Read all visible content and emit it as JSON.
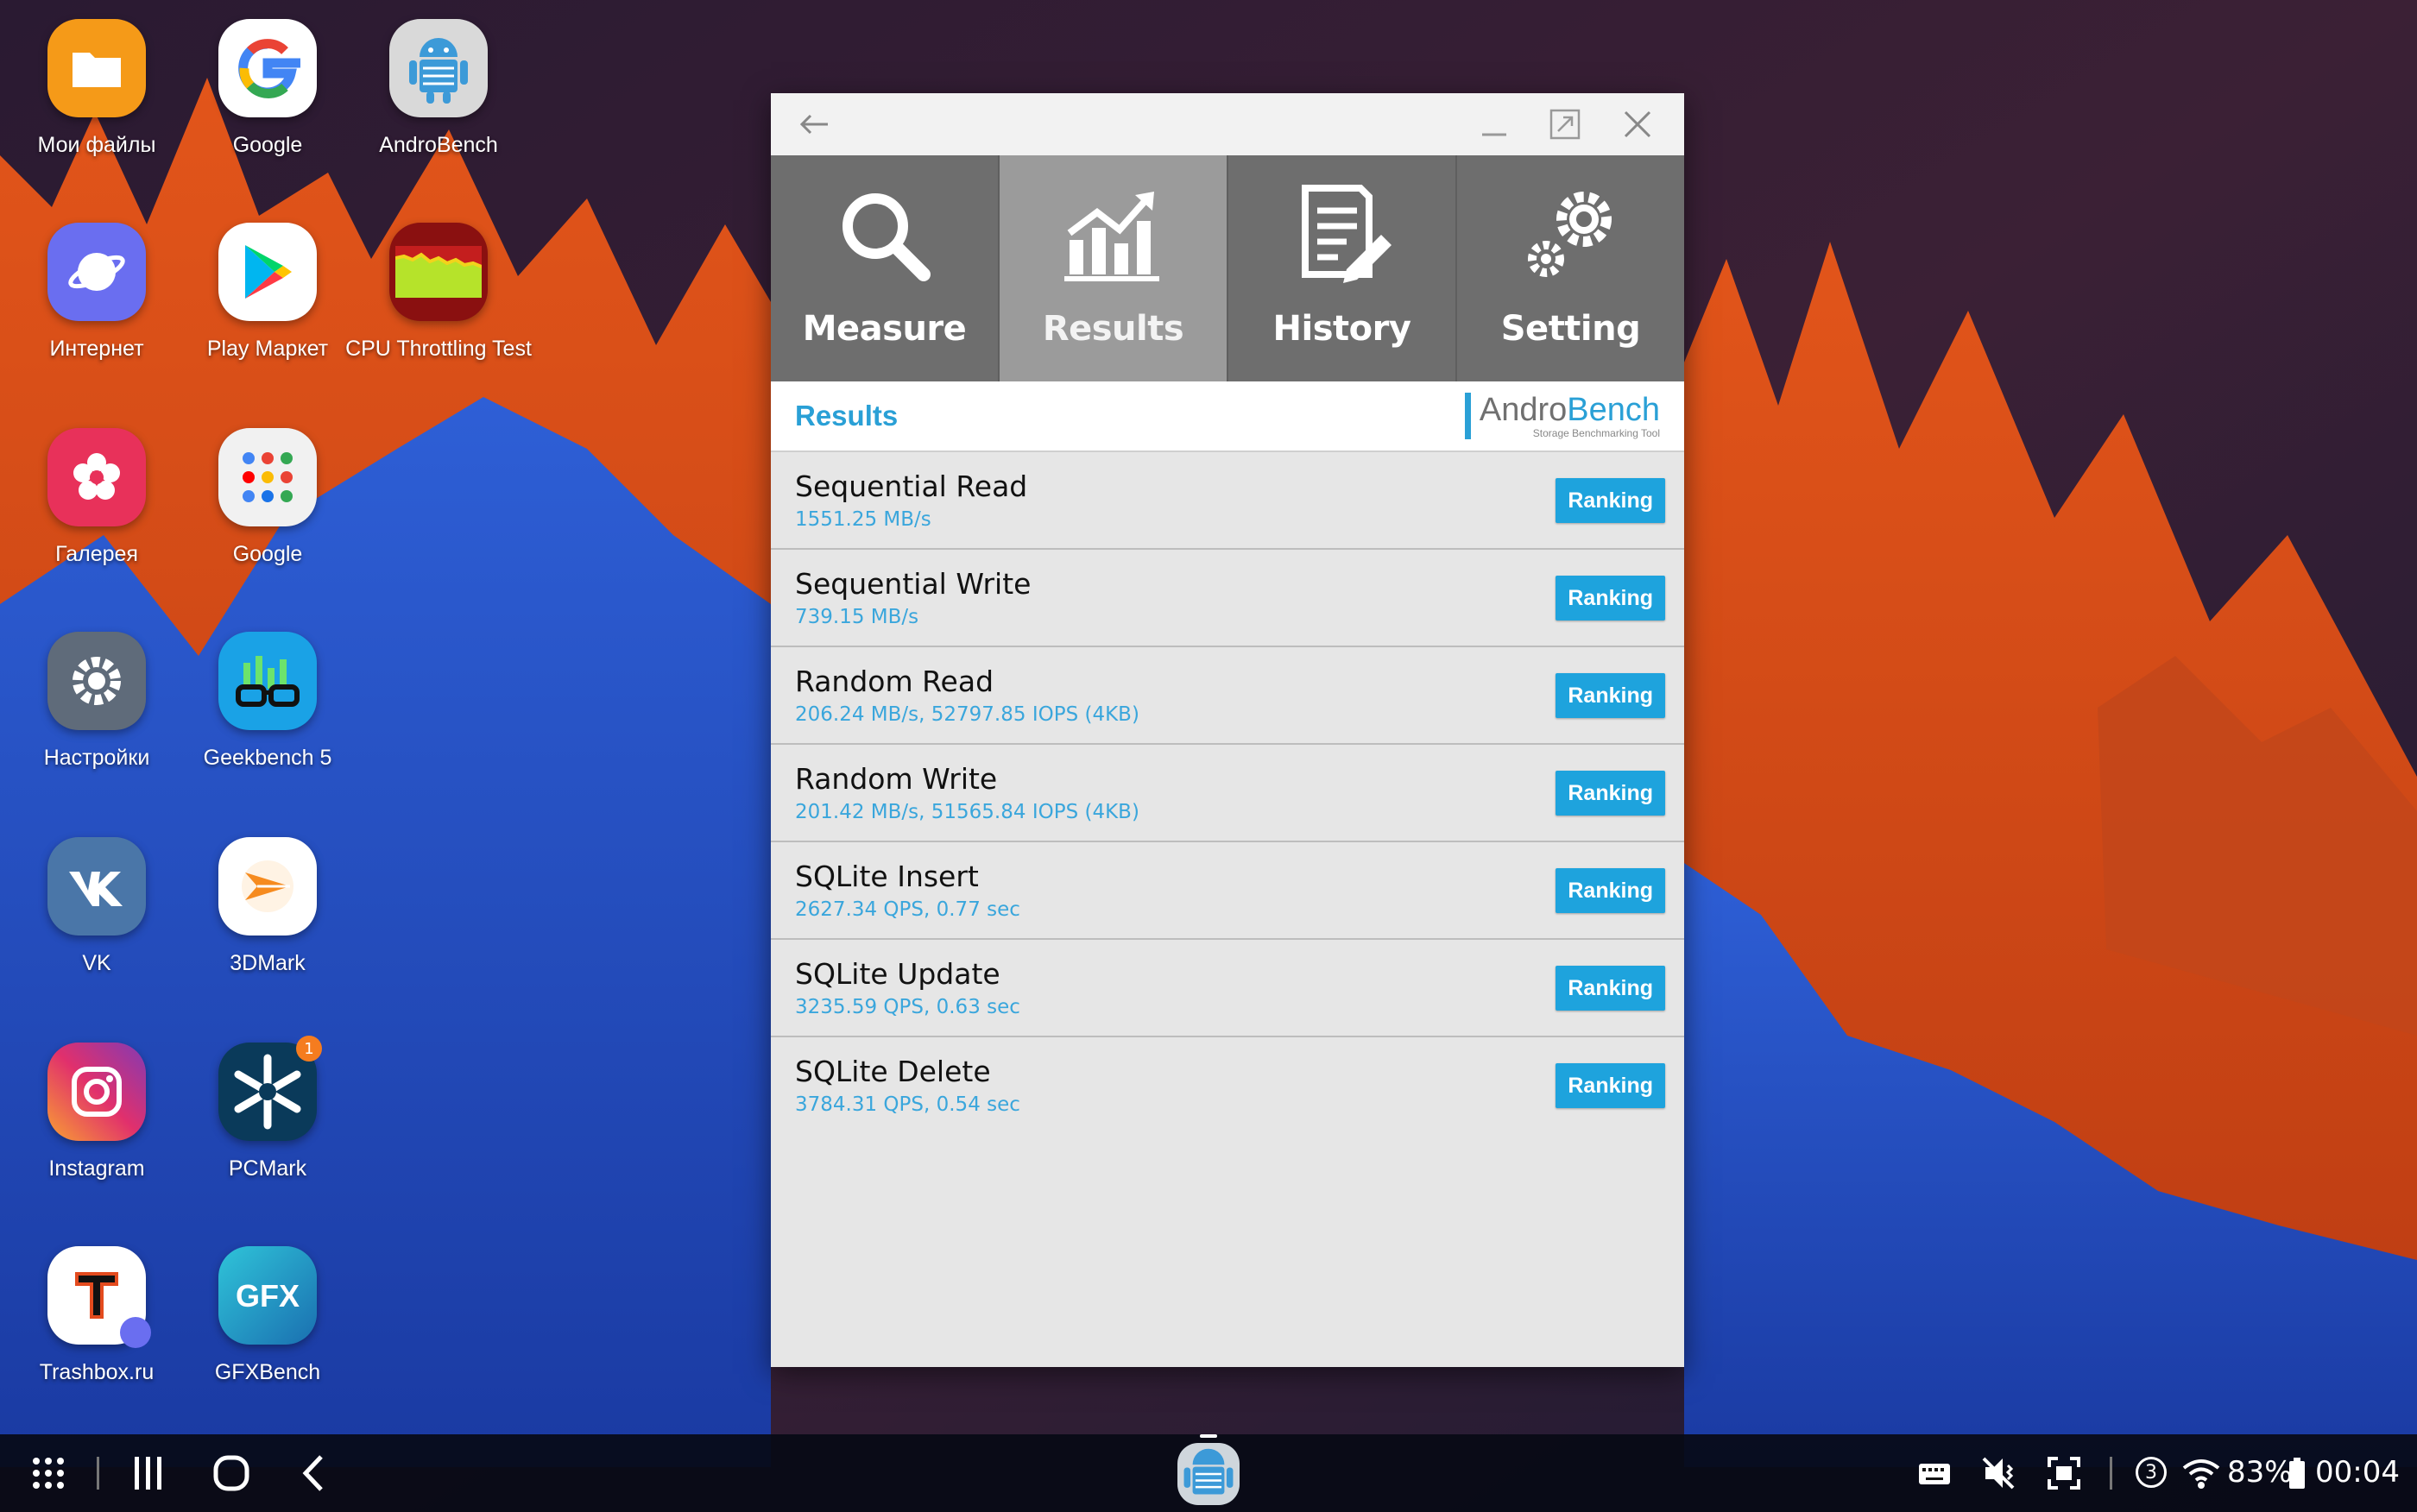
{
  "desktop": {
    "icons": [
      {
        "label": "Мои файлы"
      },
      {
        "label": "Google"
      },
      {
        "label": "AndroBench"
      },
      {
        "label": "Интернет"
      },
      {
        "label": "Play Маркет"
      },
      {
        "label": "CPU Throttling Test"
      },
      {
        "label": "Галерея"
      },
      {
        "label": "Google"
      },
      {
        "label": "Настройки"
      },
      {
        "label": "Geekbench 5"
      },
      {
        "label": "VK"
      },
      {
        "label": "3DMark"
      },
      {
        "label": "Instagram"
      },
      {
        "label": "PCMark",
        "badge": "1"
      },
      {
        "label": "Trashbox.ru"
      },
      {
        "label": "GFXBench"
      }
    ]
  },
  "window": {
    "tabs": [
      {
        "label": "Measure",
        "icon": "magnifier-icon"
      },
      {
        "label": "Results",
        "icon": "chart-icon"
      },
      {
        "label": "History",
        "icon": "document-edit-icon"
      },
      {
        "label": "Setting",
        "icon": "gears-icon"
      }
    ],
    "active_tab": "Results",
    "header_title": "Results",
    "brand": {
      "name_part1": "Andro",
      "name_part2": "Bench",
      "subtitle": "Storage Benchmarking Tool"
    },
    "ranking_label": "Ranking",
    "results": [
      {
        "title": "Sequential Read",
        "value": "1551.25 MB/s"
      },
      {
        "title": "Sequential Write",
        "value": "739.15 MB/s"
      },
      {
        "title": "Random Read",
        "value": "206.24 MB/s, 52797.85 IOPS (4KB)"
      },
      {
        "title": "Random Write",
        "value": "201.42 MB/s, 51565.84 IOPS (4KB)"
      },
      {
        "title": "SQLite Insert",
        "value": "2627.34 QPS, 0.77 sec"
      },
      {
        "title": "SQLite Update",
        "value": "3235.59 QPS, 0.63 sec"
      },
      {
        "title": "SQLite Delete",
        "value": "3784.31 QPS, 0.54 sec"
      }
    ]
  },
  "status_bar": {
    "notification_count": "3",
    "battery": "83%",
    "time": "00:04"
  },
  "colors": {
    "accent": "#2aa0d6",
    "tab_bg": "#6e6e6e",
    "tab_active_bg": "#9b9b9b",
    "ranking_button": "#1ea3dd"
  }
}
